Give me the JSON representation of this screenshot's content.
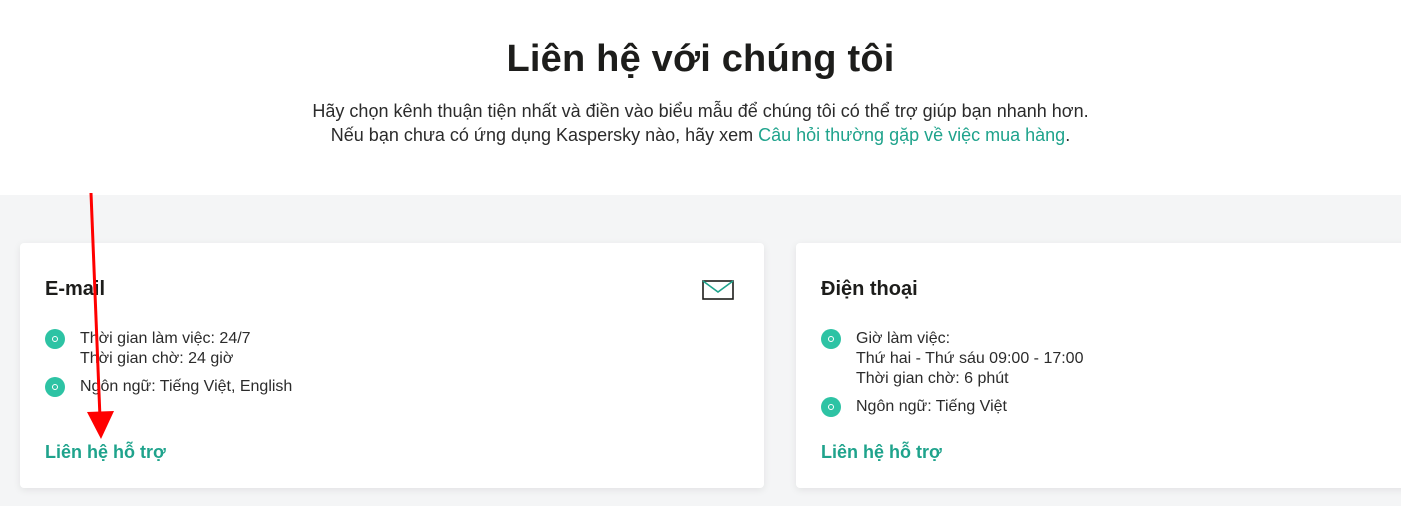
{
  "header": {
    "title": "Liên hệ với chúng tôi",
    "subtitle_line1": "Hãy chọn kênh thuận tiện nhất và điền vào biểu mẫu để chúng tôi có thể trợ giúp bạn nhanh hơn.",
    "subtitle_line2_prefix": "Nếu bạn chưa có ứng dụng Kaspersky nào, hãy xem ",
    "subtitle_line2_link": "Câu hỏi thường gặp về việc mua hàng",
    "subtitle_line2_suffix": "."
  },
  "cards": {
    "email": {
      "title": "E-mail",
      "icon": "envelope-icon",
      "bullets": [
        {
          "lines": [
            "Thời gian làm việc: 24/7",
            "Thời gian chờ: 24 giờ"
          ]
        },
        {
          "lines": [
            "Ngôn ngữ: Tiếng Việt, English"
          ]
        }
      ],
      "cta": "Liên hệ hỗ trợ"
    },
    "phone": {
      "title": "Điện thoại",
      "bullets": [
        {
          "lines": [
            "Giờ làm việc:",
            "Thứ hai - Thứ sáu 09:00 - 17:00",
            "Thời gian chờ: 6 phút"
          ]
        },
        {
          "lines": [
            "Ngôn ngữ: Tiếng Việt"
          ]
        }
      ],
      "cta": "Liên hệ hỗ trợ"
    }
  },
  "colors": {
    "accent": "#1fa38c",
    "bullet": "#2dc3a4",
    "annotation_arrow": "#ff0000",
    "band_background": "#f4f5f6"
  }
}
